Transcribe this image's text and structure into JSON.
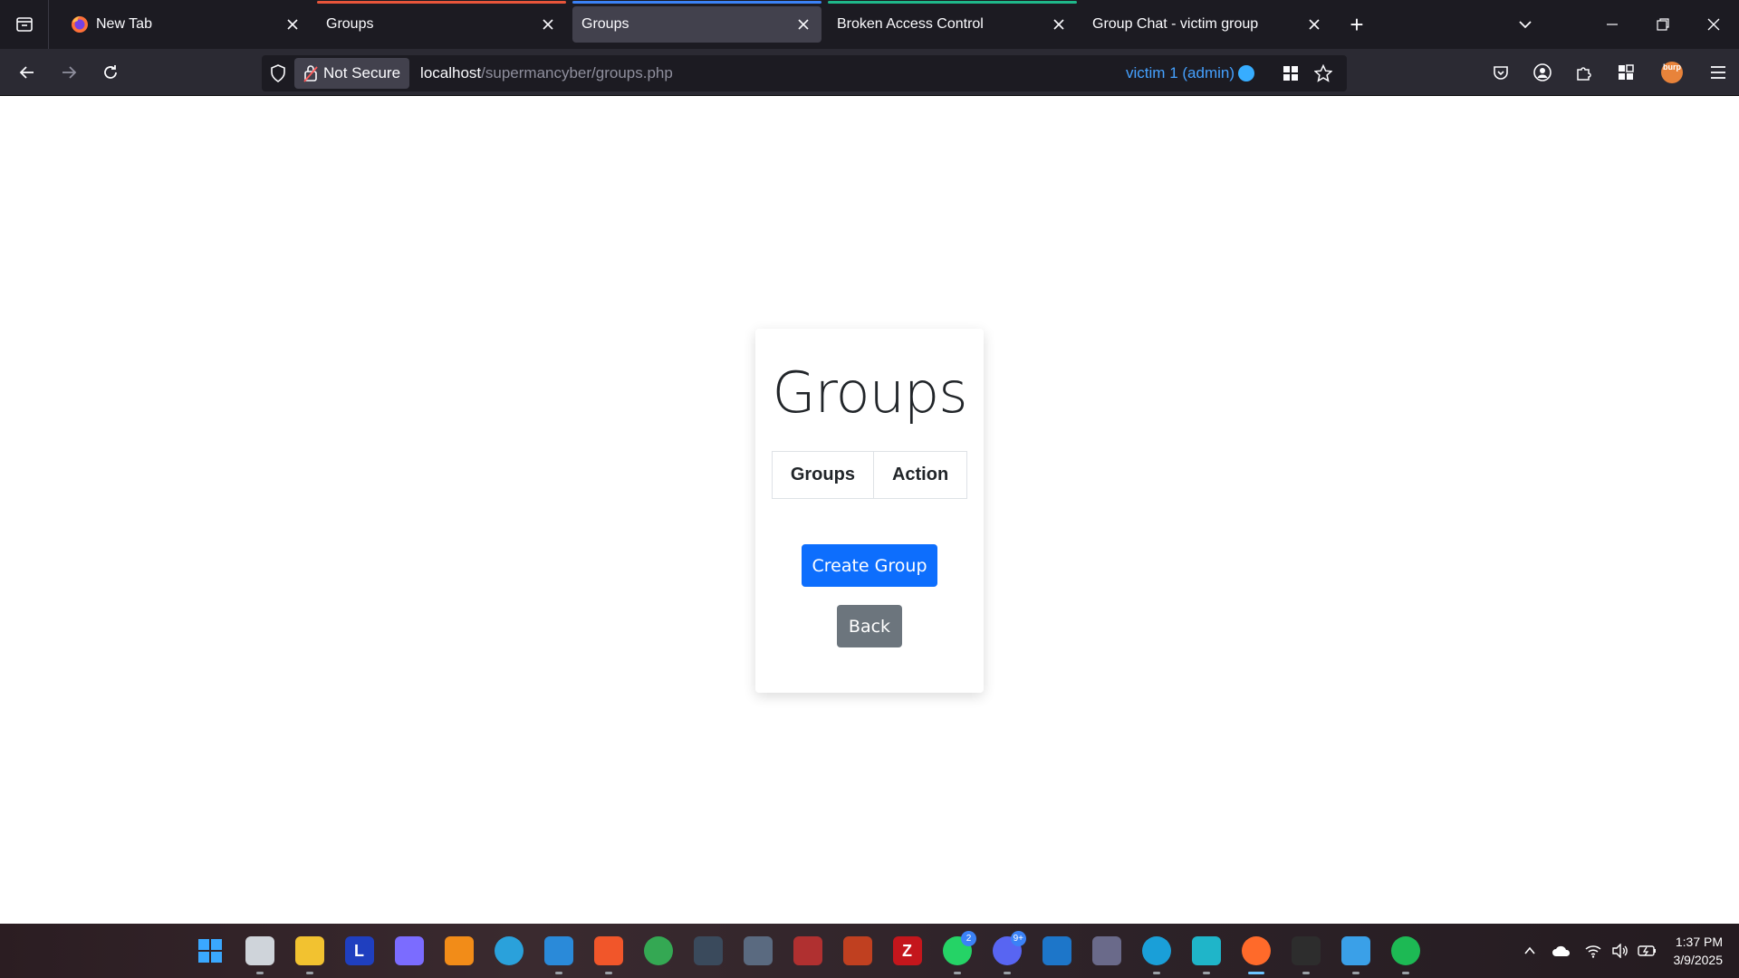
{
  "browser": {
    "tabs": [
      {
        "title": "New Tab",
        "favicon": "firefox-icon",
        "active": false,
        "accent": null
      },
      {
        "title": "Groups",
        "favicon": null,
        "active": false,
        "accent": "#e8553a"
      },
      {
        "title": "Groups",
        "favicon": null,
        "active": true,
        "accent": "#3b82f6"
      },
      {
        "title": "Broken Access Control",
        "favicon": null,
        "active": false,
        "accent": "#1fb88a"
      },
      {
        "title": "Group Chat - victim group",
        "favicon": null,
        "active": false,
        "accent": null
      }
    ],
    "security_label": "Not Secure",
    "url_host": "localhost",
    "url_path": "/supermancyber/groups.php",
    "container_label": "victim 1 (admin)",
    "container_color": "#37adff",
    "burp_extension_label": "burp"
  },
  "page": {
    "heading": "Groups",
    "table_headers": [
      "Groups",
      "Action"
    ],
    "create_button": "Create Group",
    "back_button": "Back",
    "primary_color": "#0d6efd",
    "secondary_color": "#6c757d"
  },
  "taskbar": {
    "apps": [
      {
        "name": "start-icon",
        "color": "#1e90ff",
        "glyph": "",
        "running": false
      },
      {
        "name": "task-view-icon",
        "color": "#cfd4da",
        "glyph": "",
        "running": true
      },
      {
        "name": "file-explorer-icon",
        "color": "#f2c230",
        "glyph": "",
        "running": true
      },
      {
        "name": "l-app-icon",
        "color": "#1f3fbf",
        "glyph": "L",
        "running": false
      },
      {
        "name": "game-controller-icon",
        "color": "#7b6cff",
        "glyph": "",
        "running": false
      },
      {
        "name": "search-app-icon",
        "color": "#f28c18",
        "glyph": "",
        "running": false
      },
      {
        "name": "telegram-icon",
        "color": "#2aa1db",
        "glyph": "",
        "running": false
      },
      {
        "name": "vscode-icon",
        "color": "#2a8ad9",
        "glyph": "",
        "running": true
      },
      {
        "name": "brave-icon",
        "color": "#f1562a",
        "glyph": "",
        "running": true
      },
      {
        "name": "chrome-icon",
        "color": "#34a853",
        "glyph": "",
        "running": false
      },
      {
        "name": "game-app-1-icon",
        "color": "#3a4a5c",
        "glyph": "",
        "running": false
      },
      {
        "name": "game-app-2-icon",
        "color": "#5a6a80",
        "glyph": "",
        "running": false
      },
      {
        "name": "game-app-3-icon",
        "color": "#b03030",
        "glyph": "",
        "running": false
      },
      {
        "name": "game-app-4-icon",
        "color": "#c04020",
        "glyph": "",
        "running": false
      },
      {
        "name": "filezilla-icon",
        "color": "#c4161c",
        "glyph": "Z",
        "running": false
      },
      {
        "name": "whatsapp-icon",
        "color": "#25d366",
        "glyph": "",
        "running": true,
        "badge": "2"
      },
      {
        "name": "discord-icon",
        "color": "#5865f2",
        "glyph": "",
        "running": true,
        "badge": "9+"
      },
      {
        "name": "virtualbox-icon",
        "color": "#1d76c9",
        "glyph": "",
        "running": false
      },
      {
        "name": "media-app-icon",
        "color": "#6a6a8a",
        "glyph": "",
        "running": false
      },
      {
        "name": "edge-icon",
        "color": "#1a9fd8",
        "glyph": "",
        "running": true
      },
      {
        "name": "bolt-app-icon",
        "color": "#1fb5c9",
        "glyph": "",
        "running": true
      },
      {
        "name": "firefox-icon",
        "color": "#ff6a2a",
        "glyph": "",
        "running": true,
        "active": true
      },
      {
        "name": "terminal-icon",
        "color": "#2d2d2d",
        "glyph": "",
        "running": true
      },
      {
        "name": "notepad-icon",
        "color": "#3aa0e8",
        "glyph": "",
        "running": true
      },
      {
        "name": "spotify-icon",
        "color": "#1db954",
        "glyph": "",
        "running": true
      }
    ],
    "time": "1:37 PM",
    "date": "3/9/2025"
  }
}
